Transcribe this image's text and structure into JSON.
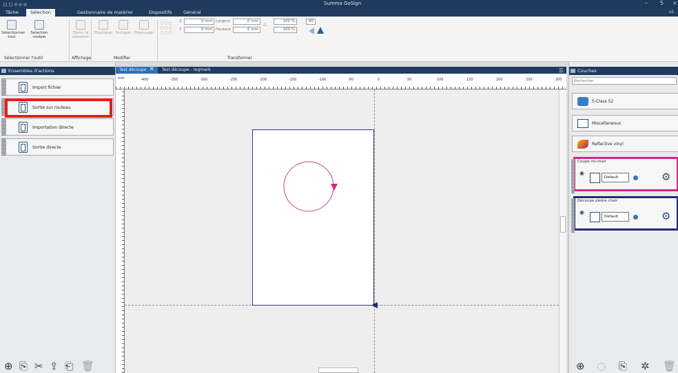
{
  "app": {
    "title": "Summa GoSign",
    "version": "v2.",
    "quick_access": "ロロ✢⊘⊚",
    "window_controls": [
      "–",
      "5",
      "×"
    ]
  },
  "menu": {
    "tabs": [
      "Tâche",
      "Sélection",
      "Gestionnaire de matériel",
      "Dispositifs",
      "Général"
    ],
    "active_tab": "Sélection"
  },
  "ribbon": {
    "select_all": "Sélectionner tout",
    "nodal_selection": "Sélection nodale",
    "zoom_selection": "Zoom la sélection",
    "duplicate": "Dupliquer",
    "group": "Grouper",
    "ungroup": "Dégrouper",
    "groups": {
      "tool": "Sélectionner l'outil",
      "display": "Affichage",
      "modify": "Modifier",
      "transform": "Transformer"
    },
    "x_label": "X",
    "y_label": "Y",
    "x_value": "0 mm",
    "y_value": "0 mm",
    "width_label": "Largeur",
    "height_label": "Hauteur",
    "width_value": "0 mm",
    "height_value": "0 mm",
    "scale_w": "100 %",
    "scale_h": "100 %",
    "rotate_value": "90"
  },
  "left_panel": {
    "title": "Ensembles d'actions",
    "items": [
      "Import fichier",
      "Sortie sur rouleau",
      "Importation directe",
      "Sortie directe"
    ]
  },
  "documents": {
    "tabs": [
      "Test découpe",
      "Test découpe - regmark"
    ],
    "active": "Test découpe"
  },
  "ruler": {
    "unit": "mm",
    "labels": [
      "-400",
      "-350",
      "-300",
      "-250",
      "-200",
      "-150",
      "-100",
      "-50",
      "0",
      "50",
      "100",
      "150",
      "200",
      "250",
      "300"
    ]
  },
  "right_panel": {
    "title": "Couches",
    "search_placeholder": "Rechercher",
    "materials": [
      "S-Class S2",
      "Miscellaneous",
      "Reflective vinyl"
    ],
    "layers": [
      {
        "name": "Coupe mi-chair",
        "preset": "Default",
        "color": "#d3258a"
      },
      {
        "name": "Découpe pleine chair",
        "preset": "Default",
        "color": "#242a7a"
      }
    ]
  },
  "colors": {
    "titlebar": "#1f3a5c",
    "accent_tab": "#2c6fb5",
    "highlight": "#e3201b",
    "cut_circle": "#c8428c",
    "sheet_border": "#35377a"
  }
}
